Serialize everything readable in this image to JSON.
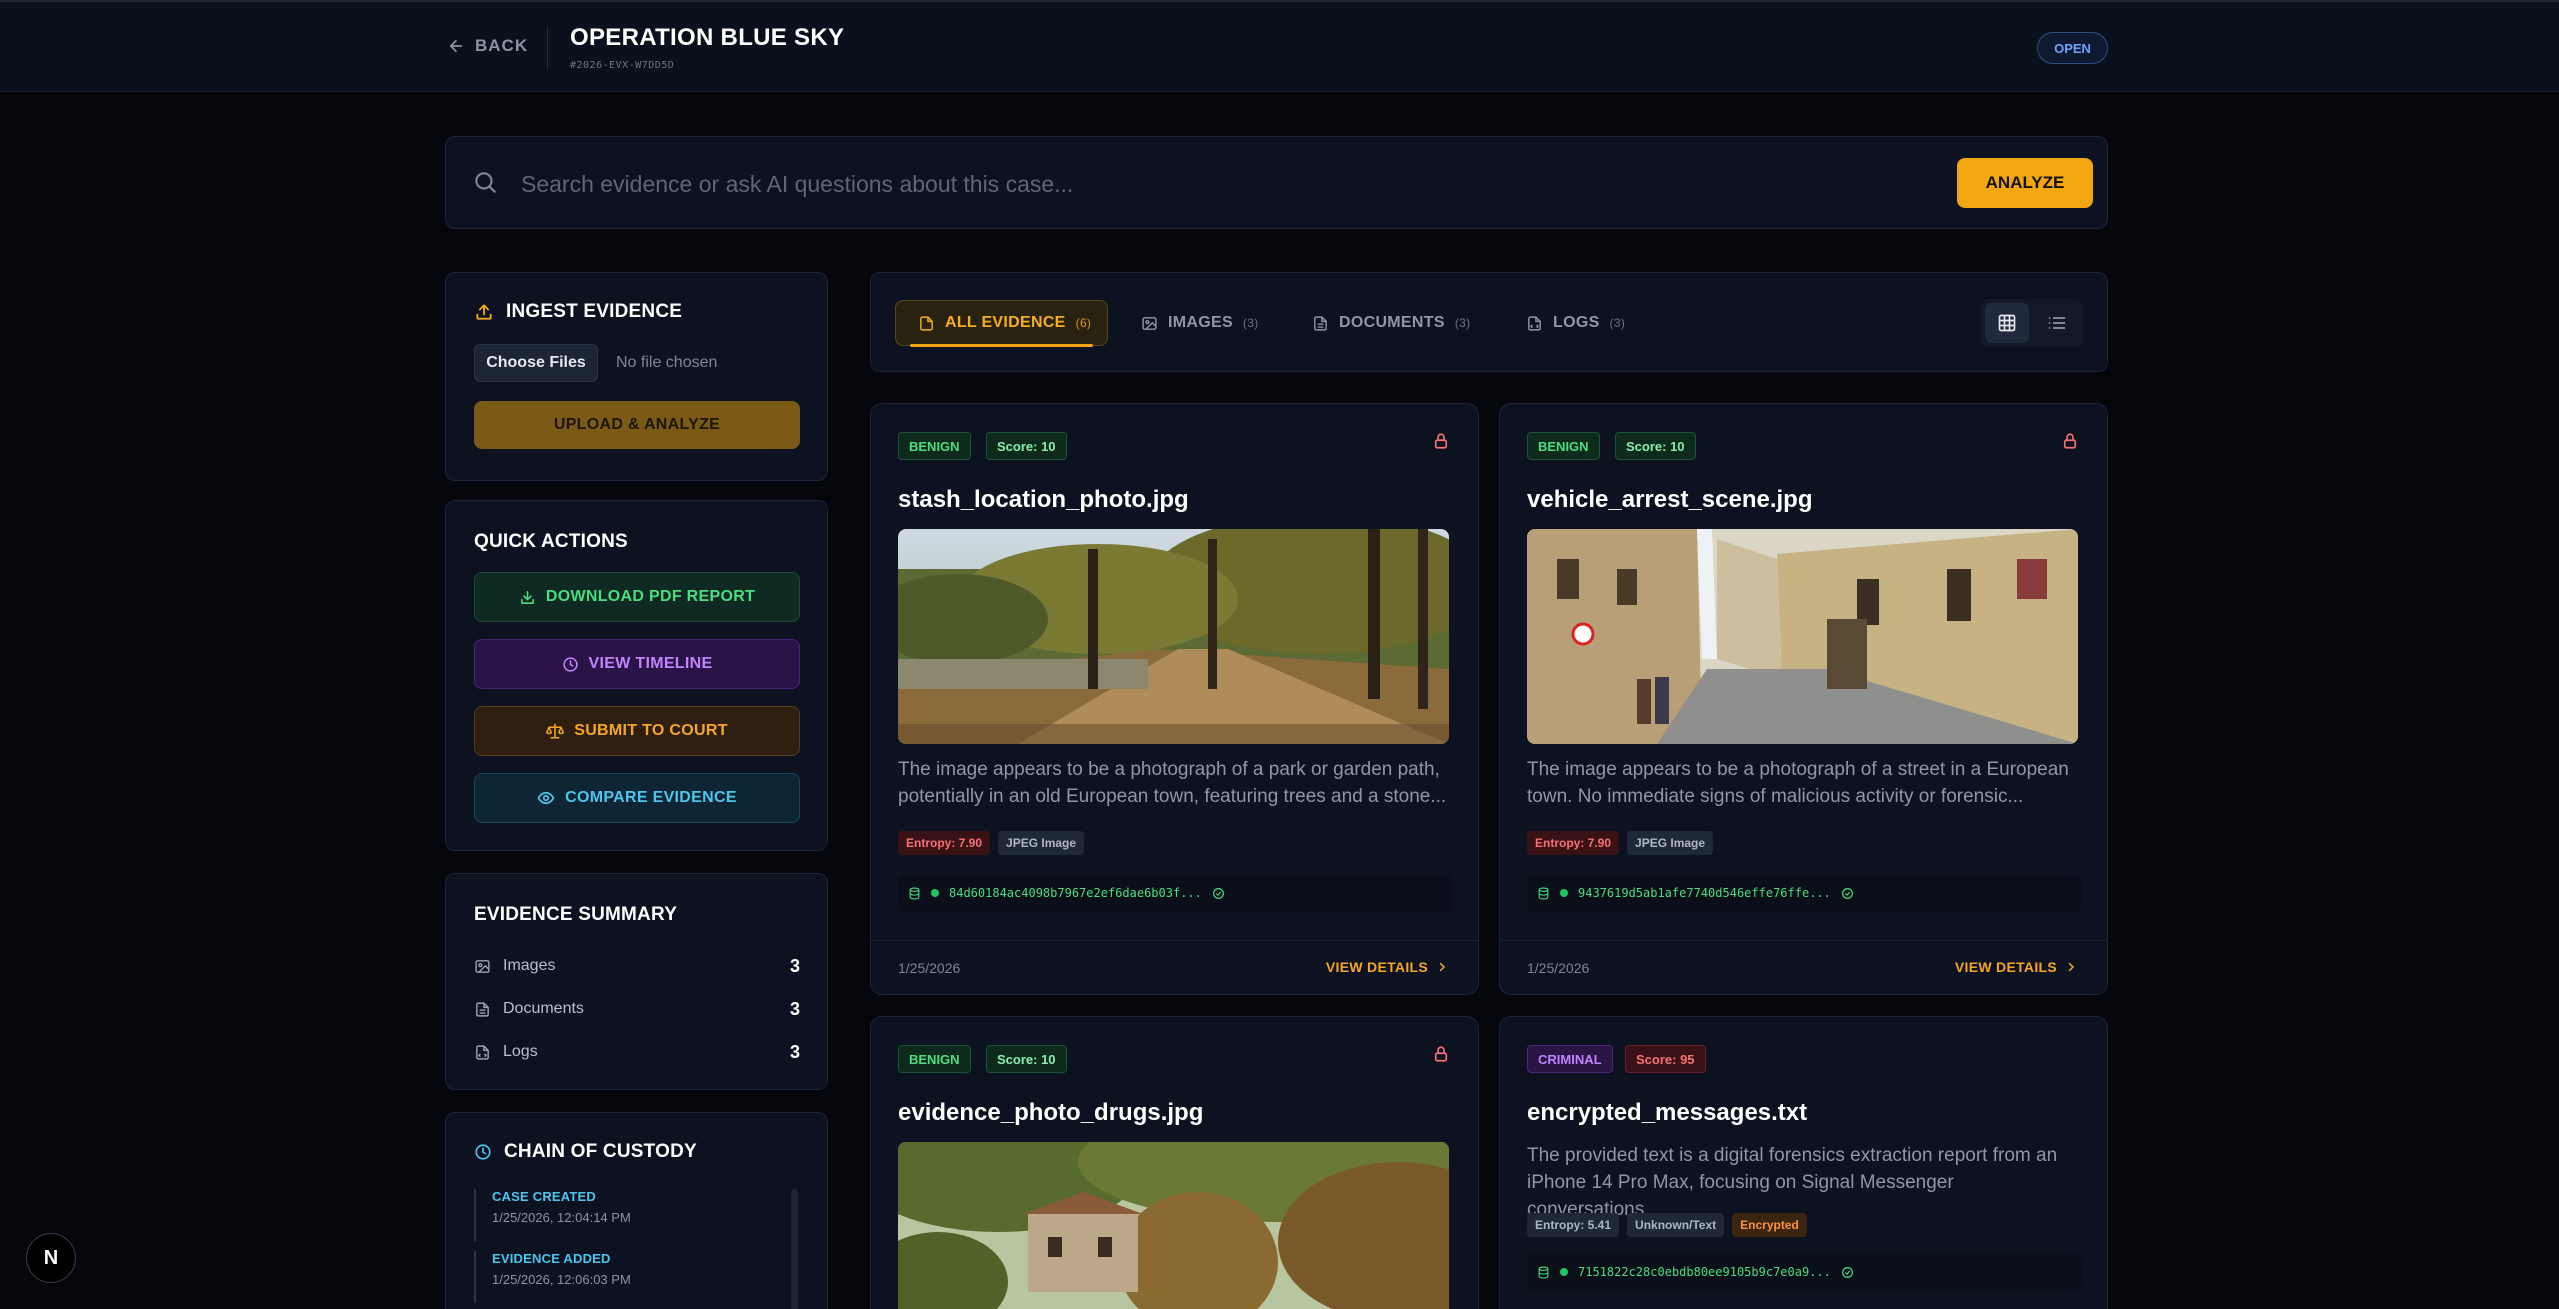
{
  "header": {
    "back_label": "BACK",
    "case_title": "OPERATION BLUE SKY",
    "case_id": "#2026-EVX-W7DD5D",
    "status": "OPEN"
  },
  "search": {
    "placeholder": "Search evidence or ask AI questions about this case...",
    "button": "ANALYZE"
  },
  "ingest": {
    "title": "INGEST EVIDENCE",
    "choose_label": "Choose Files",
    "no_file": "No file chosen",
    "upload_label": "UPLOAD & ANALYZE"
  },
  "quick_actions": {
    "title": "QUICK ACTIONS",
    "download": "DOWNLOAD PDF REPORT",
    "timeline": "VIEW TIMELINE",
    "court": "SUBMIT TO COURT",
    "compare": "COMPARE EVIDENCE"
  },
  "summary": {
    "title": "EVIDENCE SUMMARY",
    "rows": [
      {
        "label": "Images",
        "count": "3"
      },
      {
        "label": "Documents",
        "count": "3"
      },
      {
        "label": "Logs",
        "count": "3"
      }
    ]
  },
  "custody": {
    "title": "CHAIN OF CUSTODY",
    "items": [
      {
        "title": "CASE CREATED",
        "date": "1/25/2026, 12:04:14 PM"
      },
      {
        "title": "EVIDENCE ADDED",
        "date": "1/25/2026, 12:06:03 PM"
      }
    ]
  },
  "tabs": [
    {
      "label": "ALL EVIDENCE",
      "count": "(6)"
    },
    {
      "label": "IMAGES",
      "count": "(3)"
    },
    {
      "label": "DOCUMENTS",
      "count": "(3)"
    },
    {
      "label": "LOGS",
      "count": "(3)"
    }
  ],
  "cards": [
    {
      "verdict": "BENIGN",
      "score": "Score: 10",
      "title": "stash_location_photo.jpg",
      "description": "The image appears to be a photograph of a park or garden path, potentially in an old European town, featuring trees and a stone...",
      "chips": [
        "Entropy: 7.90",
        "JPEG Image"
      ],
      "hash": "84d60184ac4098b7967e2ef6dae6b03f...",
      "date": "1/25/2026",
      "link": "VIEW DETAILS"
    },
    {
      "verdict": "BENIGN",
      "score": "Score: 10",
      "title": "vehicle_arrest_scene.jpg",
      "description": "The image appears to be a photograph of a street in a European town. No immediate signs of malicious activity or forensic...",
      "chips": [
        "Entropy: 7.90",
        "JPEG Image"
      ],
      "hash": "9437619d5ab1afe7740d546effe76ffe...",
      "date": "1/25/2026",
      "link": "VIEW DETAILS"
    },
    {
      "verdict": "BENIGN",
      "score": "Score: 10",
      "title": "evidence_photo_drugs.jpg"
    },
    {
      "verdict": "CRIMINAL",
      "score": "Score: 95",
      "title": "encrypted_messages.txt",
      "description": "The provided text is a digital forensics extraction report from an iPhone 14 Pro Max, focusing on Signal Messenger conversations...",
      "chips": [
        "Entropy: 5.41",
        "Unknown/Text",
        "Encrypted"
      ],
      "hash": "7151822c28c0ebdb80ee9105b9c7e0a9..."
    }
  ],
  "framework_badge": "N",
  "colors": {
    "accent": "#f2a60f",
    "benign": "#4ade80",
    "criminal": "#c084fc",
    "danger": "#f87171",
    "info": "#6ea1ff"
  }
}
